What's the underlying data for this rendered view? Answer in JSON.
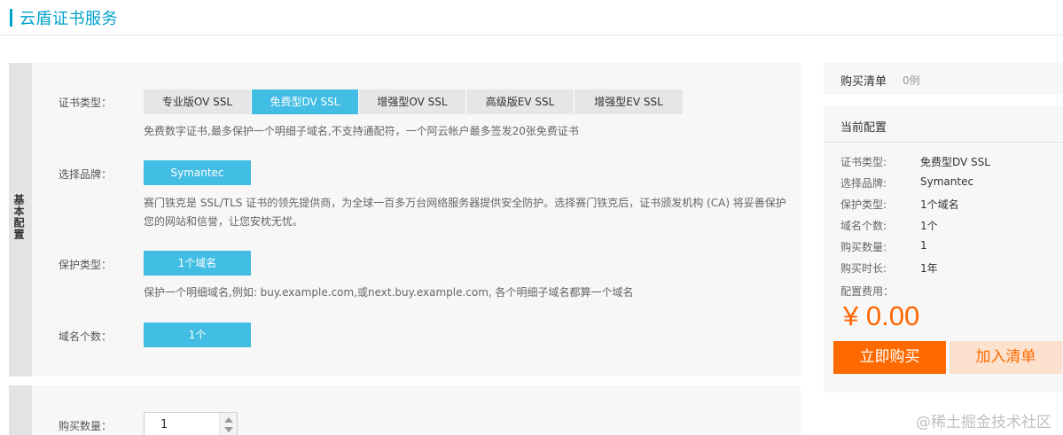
{
  "header": {
    "title": "云盾证书服务"
  },
  "config": {
    "side_label": "基本配置",
    "cert_type": {
      "label": "证书类型：",
      "options": [
        "专业版OV SSL",
        "免费型DV SSL",
        "增强型OV SSL",
        "高级版EV SSL",
        "增强型EV SSL"
      ],
      "selected": "免费型DV SSL",
      "description": "免费数字证书,最多保护一个明细子域名,不支持通配符，一个阿云帐户最多签发20张免费证书"
    },
    "brand": {
      "label": "选择品牌：",
      "value": "Symantec",
      "description_line1": "赛门铁克是 SSL/TLS 证书的领先提供商，为全球一百多万台网络服务器提供安全防护。选择赛门铁克后，证书颁发机构 (CA) 将妥善保护",
      "description_line2": "您的网站和信誉，让您安枕无忧。"
    },
    "protect_type": {
      "label": "保护类型：",
      "value": "1个域名",
      "description": "保护一个明细域名,例如: buy.example.com,或next.buy.example.com, 各个明细子域名都算一个域名"
    },
    "domain_count": {
      "label": "域名个数：",
      "value": "1个"
    }
  },
  "quantity": {
    "label": "购买数量：",
    "value": "1"
  },
  "cart": {
    "title": "购买清单",
    "count": "0例"
  },
  "current": {
    "title": "当前配置",
    "rows": [
      {
        "label": "证书类型:",
        "value": "免费型DV SSL"
      },
      {
        "label": "选择品牌:",
        "value": "Symantec"
      },
      {
        "label": "保护类型:",
        "value": "1个域名"
      },
      {
        "label": "域名个数:",
        "value": "1个"
      },
      {
        "label": "购买数量:",
        "value": "1"
      },
      {
        "label": "购买时长:",
        "value": "1年"
      }
    ],
    "fee_label": "配置费用：",
    "price": "¥ 0.00",
    "buy_label": "立即购买",
    "add_label": "加入清单"
  },
  "watermark": "@稀土掘金技术社区",
  "colors": {
    "accent": "#42bde3",
    "title": "#00a2ca",
    "price": "#ff6600",
    "buy": "#ff6a00",
    "add_bg": "#fde1cf"
  }
}
